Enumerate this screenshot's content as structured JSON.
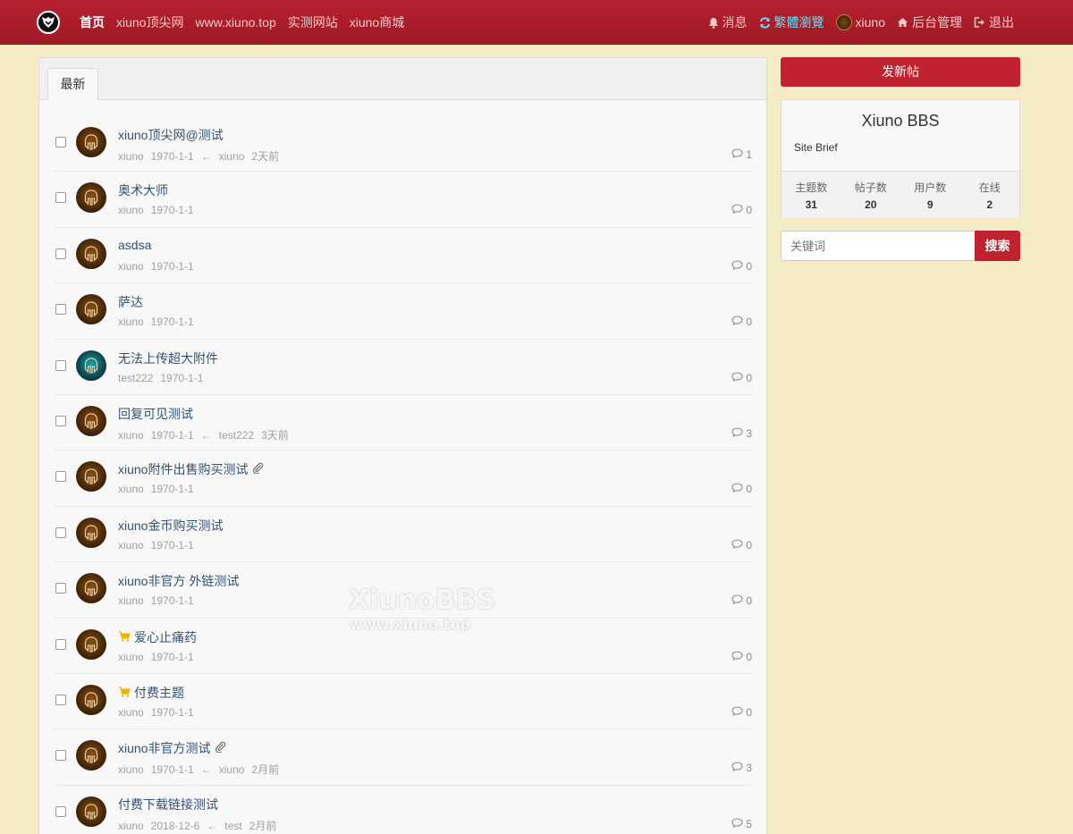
{
  "colors": {
    "nav_bg": "#b5202e",
    "page_bg": "#f5ebc4",
    "accent": "#c0222f",
    "link": "#35516e",
    "muted": "#a0a0a0",
    "trad_link": "#66ddee"
  },
  "nav": {
    "logo_icon": "xiuno-logo-icon",
    "left": [
      {
        "label": "首页",
        "active": true
      },
      {
        "label": "xiuno顶尖网"
      },
      {
        "label": "www.xiuno.top"
      },
      {
        "label": "实测网站"
      },
      {
        "label": "xiuno商城"
      }
    ],
    "right": {
      "messages": "消息",
      "traditional": "繁體瀏覽",
      "user": "xiuno",
      "admin": "后台管理",
      "logout": "退出"
    }
  },
  "tabs": [
    {
      "label": "最新",
      "active": true
    }
  ],
  "threads": [
    {
      "subject": "xiuno顶尖网@测试",
      "author": "xiuno",
      "date": "1970-1-1",
      "last_user": "xiuno",
      "last_time": "2天前",
      "replies": "1",
      "avatar": "default",
      "cart": false,
      "clip": false
    },
    {
      "subject": "奥术大师",
      "author": "xiuno",
      "date": "1970-1-1",
      "replies": "0",
      "avatar": "default",
      "cart": false,
      "clip": false
    },
    {
      "subject": "asdsa",
      "author": "xiuno",
      "date": "1970-1-1",
      "replies": "0",
      "avatar": "default",
      "cart": false,
      "clip": false
    },
    {
      "subject": "萨达",
      "author": "xiuno",
      "date": "1970-1-1",
      "replies": "0",
      "avatar": "default",
      "cart": false,
      "clip": false
    },
    {
      "subject": "无法上传超大附件",
      "author": "test222",
      "date": "1970-1-1",
      "replies": "0",
      "avatar": "alt",
      "cart": false,
      "clip": false
    },
    {
      "subject": "回复可见测试",
      "author": "xiuno",
      "date": "1970-1-1",
      "last_user": "test222",
      "last_time": "3天前",
      "replies": "3",
      "avatar": "default",
      "cart": false,
      "clip": false
    },
    {
      "subject": "xiuno附件出售购买测试",
      "author": "xiuno",
      "date": "1970-1-1",
      "replies": "0",
      "avatar": "default",
      "cart": false,
      "clip": true
    },
    {
      "subject": "xiuno金币购买测试",
      "author": "xiuno",
      "date": "1970-1-1",
      "replies": "0",
      "avatar": "default",
      "cart": false,
      "clip": false
    },
    {
      "subject": "xiuno非官方 外链测试",
      "author": "xiuno",
      "date": "1970-1-1",
      "replies": "0",
      "avatar": "default",
      "cart": false,
      "clip": false
    },
    {
      "subject": "爱心止痛药",
      "author": "xiuno",
      "date": "1970-1-1",
      "replies": "0",
      "avatar": "default",
      "cart": true,
      "clip": false
    },
    {
      "subject": "付费主题",
      "author": "xiuno",
      "date": "1970-1-1",
      "replies": "0",
      "avatar": "default",
      "cart": true,
      "clip": false
    },
    {
      "subject": "xiuno非官方测试",
      "author": "xiuno",
      "date": "1970-1-1",
      "last_user": "xiuno",
      "last_time": "2月前",
      "replies": "3",
      "avatar": "default",
      "cart": false,
      "clip": true
    },
    {
      "subject": "付费下载链接测试",
      "author": "xiuno",
      "date": "2018-12-6",
      "last_user": "test",
      "last_time": "2月前",
      "replies": "5",
      "avatar": "default",
      "cart": false,
      "clip": false
    }
  ],
  "watermark": {
    "title": "XiunoBBS",
    "url": "www.xiuno.top"
  },
  "sidebar": {
    "post_button": "发新帖",
    "site_title": "Xiuno BBS",
    "site_brief": "Site Brief",
    "stats": [
      {
        "label": "主题数",
        "value": "31"
      },
      {
        "label": "帖子数",
        "value": "20"
      },
      {
        "label": "用户数",
        "value": "9"
      },
      {
        "label": "在线",
        "value": "2"
      }
    ],
    "search_placeholder": "关键词",
    "search_button": "搜索"
  }
}
